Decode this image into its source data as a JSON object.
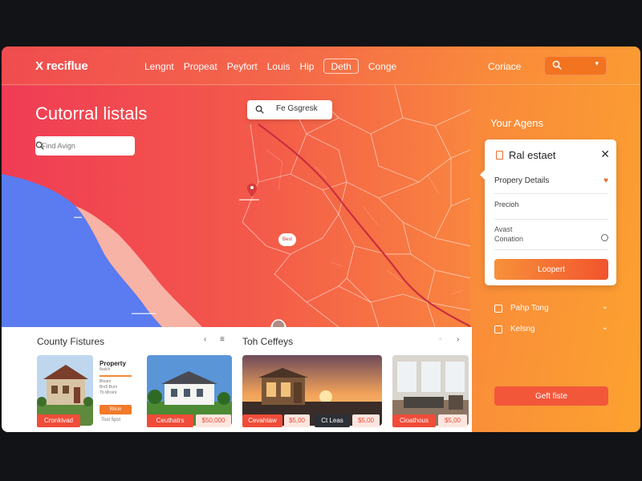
{
  "app": {
    "logo": "X reciflue"
  },
  "nav": {
    "items": [
      "Lengnt",
      "Propeat",
      "Peyfort",
      "Louis",
      "Hip",
      "Deth",
      "Conge"
    ],
    "active_index": 5
  },
  "header": {
    "contact": "Coriace"
  },
  "map": {
    "title": "Cutorral listals",
    "search_placeholder": "Find Avign",
    "popup_text": "Fe Gsgresk",
    "pin_label": "Best"
  },
  "side": {
    "title": "Your Agens",
    "card": {
      "title": "Ral estaet",
      "field_property": "Propery Details",
      "field_precision": "Precioh",
      "field_avast": "Avast",
      "field_condition": "Conation",
      "button": "Loopert"
    },
    "accordion": [
      "Pahp Tong",
      "Kelsng"
    ],
    "cta": "Geft fiste"
  },
  "listings": {
    "section1_title": "County Fistures",
    "section2_title": "Toh Ceffeys",
    "featured": {
      "title": "Property",
      "subtitle": "Ibalch",
      "lines": [
        "Bloarn",
        "Brs5 Burn",
        "Tb Mroint"
      ],
      "button": "Rlicin",
      "sub": "Tost 5pst"
    },
    "tags": [
      "Cronkivad",
      "Ceuthatrs",
      "Cevahtaw",
      "Cioathous"
    ],
    "prices": [
      "$50.000",
      "$5.00",
      "$5.00",
      "$5.00"
    ],
    "dark_tag": "Ct Leas",
    "price_labels": [
      "$50,000",
      "$5,00",
      "$5,00",
      "$5,00"
    ]
  },
  "colors": {
    "brand_red": "#f04c4f",
    "brand_orange": "#fca22f",
    "accent": "#e8702e",
    "ocean": "#5b7ff2"
  },
  "icons": [
    "search-icon",
    "chevron-down-icon",
    "close-icon",
    "heart-icon",
    "gear-icon",
    "map-pin-icon"
  ]
}
